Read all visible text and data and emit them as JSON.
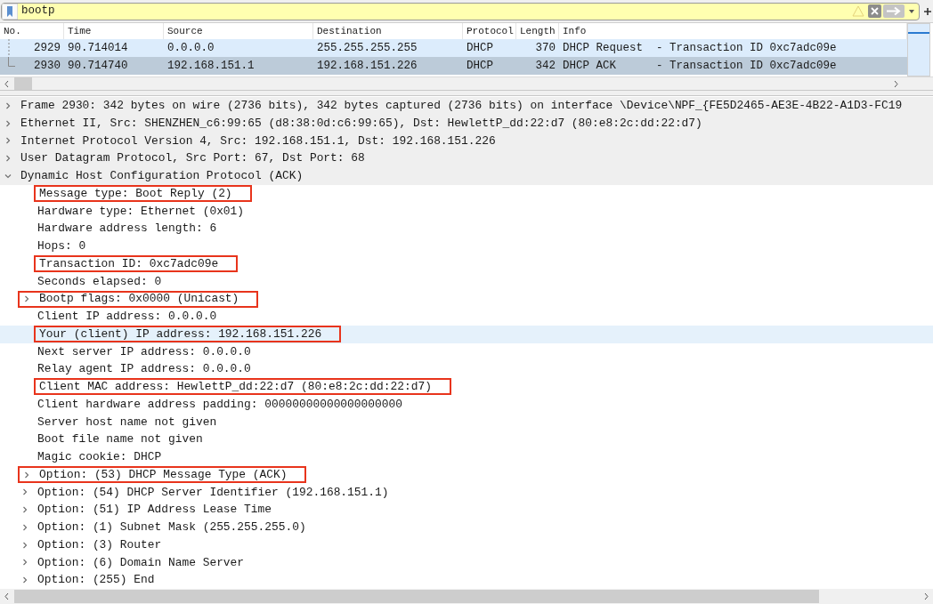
{
  "filter": {
    "value": "bootp"
  },
  "packet_list": {
    "columns": [
      "No.",
      "Time",
      "Source",
      "Destination",
      "Protocol",
      "Length",
      "Info"
    ],
    "rows": [
      {
        "cells": [
          "2929",
          "90.714014",
          "0.0.0.0",
          "255.255.255.255",
          "DHCP",
          "370",
          "DHCP Request  - Transaction ID 0xc7adc09e"
        ],
        "selected": false
      },
      {
        "cells": [
          "2930",
          "90.714740",
          "192.168.151.1",
          "192.168.151.226",
          "DHCP",
          "342",
          "DHCP ACK      - Transaction ID 0xc7adc09e"
        ],
        "selected": true
      }
    ]
  },
  "details": [
    {
      "label": "Frame 2930: 342 bytes on wire (2736 bits), 342 bytes captured (2736 bits) on interface \\Device\\NPF_{FE5D2465-AE3E-4B22-A1D3-FC19",
      "expanded": false,
      "has_children": true,
      "highlighted": false,
      "selected": false
    },
    {
      "label": "Ethernet II, Src: SHENZHEN_c6:99:65 (d8:38:0d:c6:99:65), Dst: HewlettP_dd:22:d7 (80:e8:2c:dd:22:d7)",
      "expanded": false,
      "has_children": true,
      "highlighted": false,
      "selected": false
    },
    {
      "label": "Internet Protocol Version 4, Src: 192.168.151.1, Dst: 192.168.151.226",
      "expanded": false,
      "has_children": true,
      "highlighted": false,
      "selected": false
    },
    {
      "label": "User Datagram Protocol, Src Port: 67, Dst Port: 68",
      "expanded": false,
      "has_children": true,
      "highlighted": false,
      "selected": false
    },
    {
      "label": "Dynamic Host Configuration Protocol (ACK)",
      "expanded": true,
      "has_children": true,
      "highlighted": false,
      "selected": false,
      "children": [
        {
          "label": "Message type: Boot Reply (2)",
          "has_children": false,
          "highlighted": true,
          "selected": false
        },
        {
          "label": "Hardware type: Ethernet (0x01)",
          "has_children": false,
          "highlighted": false,
          "selected": false
        },
        {
          "label": "Hardware address length: 6",
          "has_children": false,
          "highlighted": false,
          "selected": false
        },
        {
          "label": "Hops: 0",
          "has_children": false,
          "highlighted": false,
          "selected": false
        },
        {
          "label": "Transaction ID: 0xc7adc09e",
          "has_children": false,
          "highlighted": true,
          "selected": false
        },
        {
          "label": "Seconds elapsed: 0",
          "has_children": false,
          "highlighted": false,
          "selected": false
        },
        {
          "label": "Bootp flags: 0x0000 (Unicast)",
          "has_children": true,
          "expanded": false,
          "highlighted": true,
          "selected": false
        },
        {
          "label": "Client IP address: 0.0.0.0",
          "has_children": false,
          "highlighted": false,
          "selected": false
        },
        {
          "label": "Your (client) IP address: 192.168.151.226",
          "has_children": false,
          "highlighted": true,
          "selected": true
        },
        {
          "label": "Next server IP address: 0.0.0.0",
          "has_children": false,
          "highlighted": false,
          "selected": false
        },
        {
          "label": "Relay agent IP address: 0.0.0.0",
          "has_children": false,
          "highlighted": false,
          "selected": false
        },
        {
          "label": "Client MAC address: HewlettP_dd:22:d7 (80:e8:2c:dd:22:d7)",
          "has_children": false,
          "highlighted": true,
          "selected": false
        },
        {
          "label": "Client hardware address padding: 00000000000000000000",
          "has_children": false,
          "highlighted": false,
          "selected": false
        },
        {
          "label": "Server host name not given",
          "has_children": false,
          "highlighted": false,
          "selected": false
        },
        {
          "label": "Boot file name not given",
          "has_children": false,
          "highlighted": false,
          "selected": false
        },
        {
          "label": "Magic cookie: DHCP",
          "has_children": false,
          "highlighted": false,
          "selected": false
        },
        {
          "label": "Option: (53) DHCP Message Type (ACK)",
          "has_children": true,
          "expanded": false,
          "highlighted": true,
          "selected": false
        },
        {
          "label": "Option: (54) DHCP Server Identifier (192.168.151.1)",
          "has_children": true,
          "expanded": false,
          "highlighted": false,
          "selected": false
        },
        {
          "label": "Option: (51) IP Address Lease Time",
          "has_children": true,
          "expanded": false,
          "highlighted": false,
          "selected": false
        },
        {
          "label": "Option: (1) Subnet Mask (255.255.255.0)",
          "has_children": true,
          "expanded": false,
          "highlighted": false,
          "selected": false
        },
        {
          "label": "Option: (3) Router",
          "has_children": true,
          "expanded": false,
          "highlighted": false,
          "selected": false
        },
        {
          "label": "Option: (6) Domain Name Server",
          "has_children": true,
          "expanded": false,
          "highlighted": false,
          "selected": false
        },
        {
          "label": "Option: (255) End",
          "has_children": true,
          "expanded": false,
          "highlighted": false,
          "selected": false
        }
      ]
    }
  ]
}
